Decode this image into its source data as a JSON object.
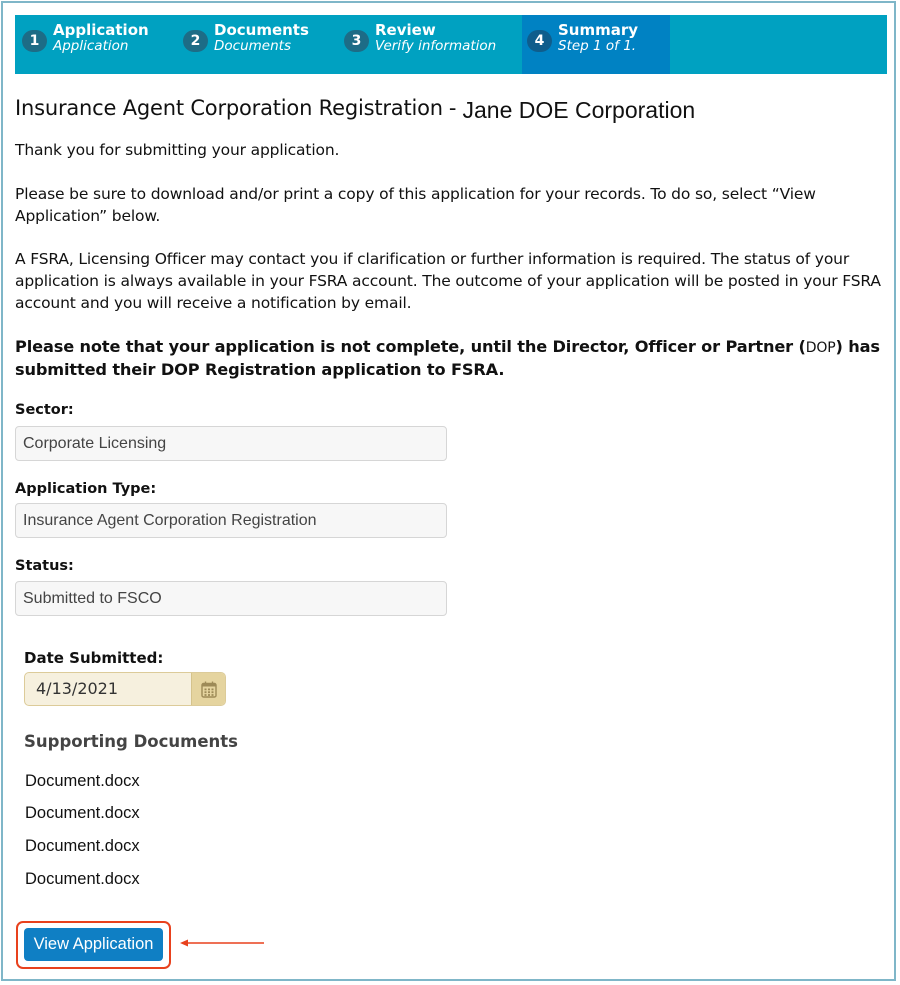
{
  "wizard": {
    "steps": [
      {
        "number": "1",
        "title": "Application",
        "subtitle": "Application",
        "active": false
      },
      {
        "number": "2",
        "title": "Documents",
        "subtitle": "Documents",
        "active": false
      },
      {
        "number": "3",
        "title": "Review",
        "subtitle": "Verify information",
        "active": false
      },
      {
        "number": "4",
        "title": "Summary",
        "subtitle": "Step 1 of 1.",
        "active": true
      }
    ],
    "colors": {
      "bar": "#00a1c1",
      "active_step": "#0082c3"
    }
  },
  "header": {
    "title": "Insurance Agent Corporation Registration",
    "separator": "-",
    "corporation": "Jane DOE Corporation"
  },
  "messages": {
    "thank_you": "Thank you for submitting your application.",
    "download_notice": "Please be sure to download and/or print a copy of this application for your records. To do so, select “View Application” below.",
    "contact_notice": "A FSRA, Licensing Officer may contact you if clarification or further information is required. The status of your application is always available in your FSRA account. The outcome of your application will be posted in your FSRA account and you will receive a notification by email.",
    "warning_before": "Please note that your application is not complete, until the Director, Officer or Partner (",
    "warning_abbr": "DOP",
    "warning_after": ") has submitted their DOP Registration application to FSRA."
  },
  "fields": {
    "sector": {
      "label": "Sector:",
      "value": "Corporate Licensing"
    },
    "application_type": {
      "label": "Application Type:",
      "value": "Insurance Agent Corporation Registration"
    },
    "status": {
      "label": "Status:",
      "value": "Submitted to FSCO"
    },
    "date_submitted": {
      "label": "Date Submitted:",
      "value": "4/13/2021",
      "icon": "calendar-icon"
    }
  },
  "supporting_documents": {
    "heading": "Supporting Documents",
    "files": [
      "Document.docx",
      "Document.docx",
      "Document.docx",
      "Document.docx"
    ]
  },
  "actions": {
    "view_application_label": "View Application",
    "annotation": {
      "highlight_color": "#e8411d",
      "arrow_icon": "arrow-left-icon"
    }
  }
}
